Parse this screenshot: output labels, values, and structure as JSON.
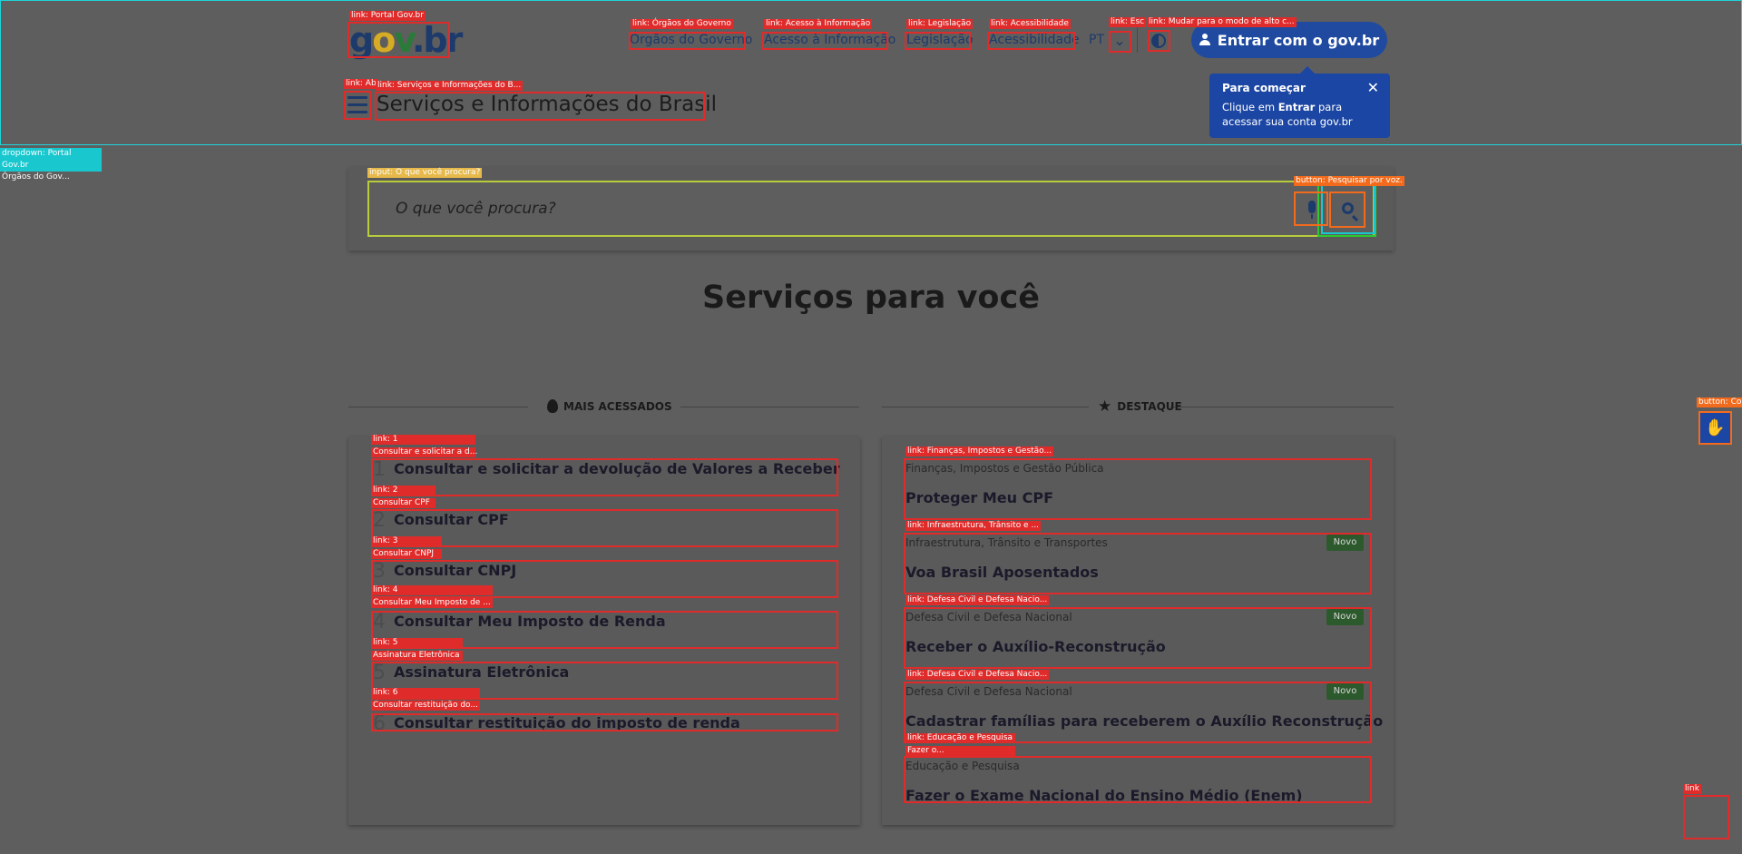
{
  "header": {
    "logo": {
      "g": "g",
      "o": "o",
      "v": "v",
      "dot": ".",
      "b": "b",
      "r": "r"
    },
    "nav_links": [
      "Órgãos do Governo",
      "Acesso à Informação",
      "Legislação",
      "Acessibilidade"
    ],
    "lang": "PT",
    "chevron": "⌄",
    "login_label": "Entrar com o gov.br",
    "site_title": "Serviços e Informações do Brasil"
  },
  "tooltip": {
    "title": "Para começar",
    "body_pre": "Clique em ",
    "body_strong": "Entrar",
    "body_post": " para acessar sua conta gov.br",
    "close": "✕"
  },
  "search": {
    "placeholder": "O que você procura?"
  },
  "main": {
    "section_title": "Serviços para você",
    "col_most": "MAIS ACESSADOS",
    "col_featured": "DESTAQUE"
  },
  "most_accessed": [
    {
      "num": "1",
      "label": "Consultar e solicitar a devolução de Valores a Receber"
    },
    {
      "num": "2",
      "label": "Consultar CPF"
    },
    {
      "num": "3",
      "label": "Consultar CNPJ"
    },
    {
      "num": "4",
      "label": "Consultar Meu Imposto de Renda"
    },
    {
      "num": "5",
      "label": "Assinatura Eletrônica"
    },
    {
      "num": "6",
      "label": "Consultar restituição do imposto de renda"
    }
  ],
  "featured": [
    {
      "category": "Finanças, Impostos e Gestão Pública",
      "title": "Proteger Meu CPF",
      "badge": ""
    },
    {
      "category": "Infraestrutura, Trânsito e Transportes",
      "title": "Voa Brasil Aposentados",
      "badge": "Novo"
    },
    {
      "category": "Defesa Civil e Defesa Nacional",
      "title": "Receber o Auxílio-Reconstrução",
      "badge": "Novo"
    },
    {
      "category": "Defesa Civil e Defesa Nacional",
      "title": "Cadastrar famílias para receberem o Auxílio Reconstrução",
      "badge": "Novo"
    },
    {
      "category": "Educação e Pesquisa",
      "title": "Fazer o Exame Nacional do Ensino Médio (Enem)",
      "badge": ""
    }
  ],
  "overlay_tags": {
    "logo": "link: Portal Gov.br",
    "orgaos": "link: Órgãos do Governo",
    "acesso": "link: Acesso à Informação",
    "legislacao": "link: Legislação",
    "acessibilidade": "link: Acessibilidade",
    "esc": "link: Esc",
    "contrast": "link: Mudar para o modo de alto c...",
    "menu": "link: Ab",
    "site_title": "link: Serviços e Informações do B...",
    "dropdown_1": "dropdown: Portal Gov.br",
    "dropdown_2": "Órgãos do Gov...",
    "input": "input: O que você procura?",
    "voice": "button: Pesquisar por voz.",
    "vlibras": "button: Co",
    "corner": "link",
    "ma_1a": "link: 1",
    "ma_1b": "Consultar e solicitar a d...",
    "ma_2a": "link: 2",
    "ma_2b": "Consultar CPF",
    "ma_3a": "link: 3",
    "ma_3b": "Consultar CNPJ",
    "ma_4a": "link: 4",
    "ma_4b": "Consultar Meu Imposto de ...",
    "ma_5a": "link: 5",
    "ma_5b": "Assinatura Eletrônica",
    "ma_6a": "link: 6",
    "ma_6b": "Consultar restituição do...",
    "dq_1": "link: Finanças, Impostos e Gestão...",
    "dq_2": "link: Infraestrutura, Trânsito e ...",
    "dq_3": "link: Defesa Civil e Defesa Nacio...",
    "dq_4": "link: Defesa Civil e Defesa Nacio...",
    "dq_5a": "link: Educação e Pesquisa",
    "dq_5b": "Fazer o..."
  }
}
